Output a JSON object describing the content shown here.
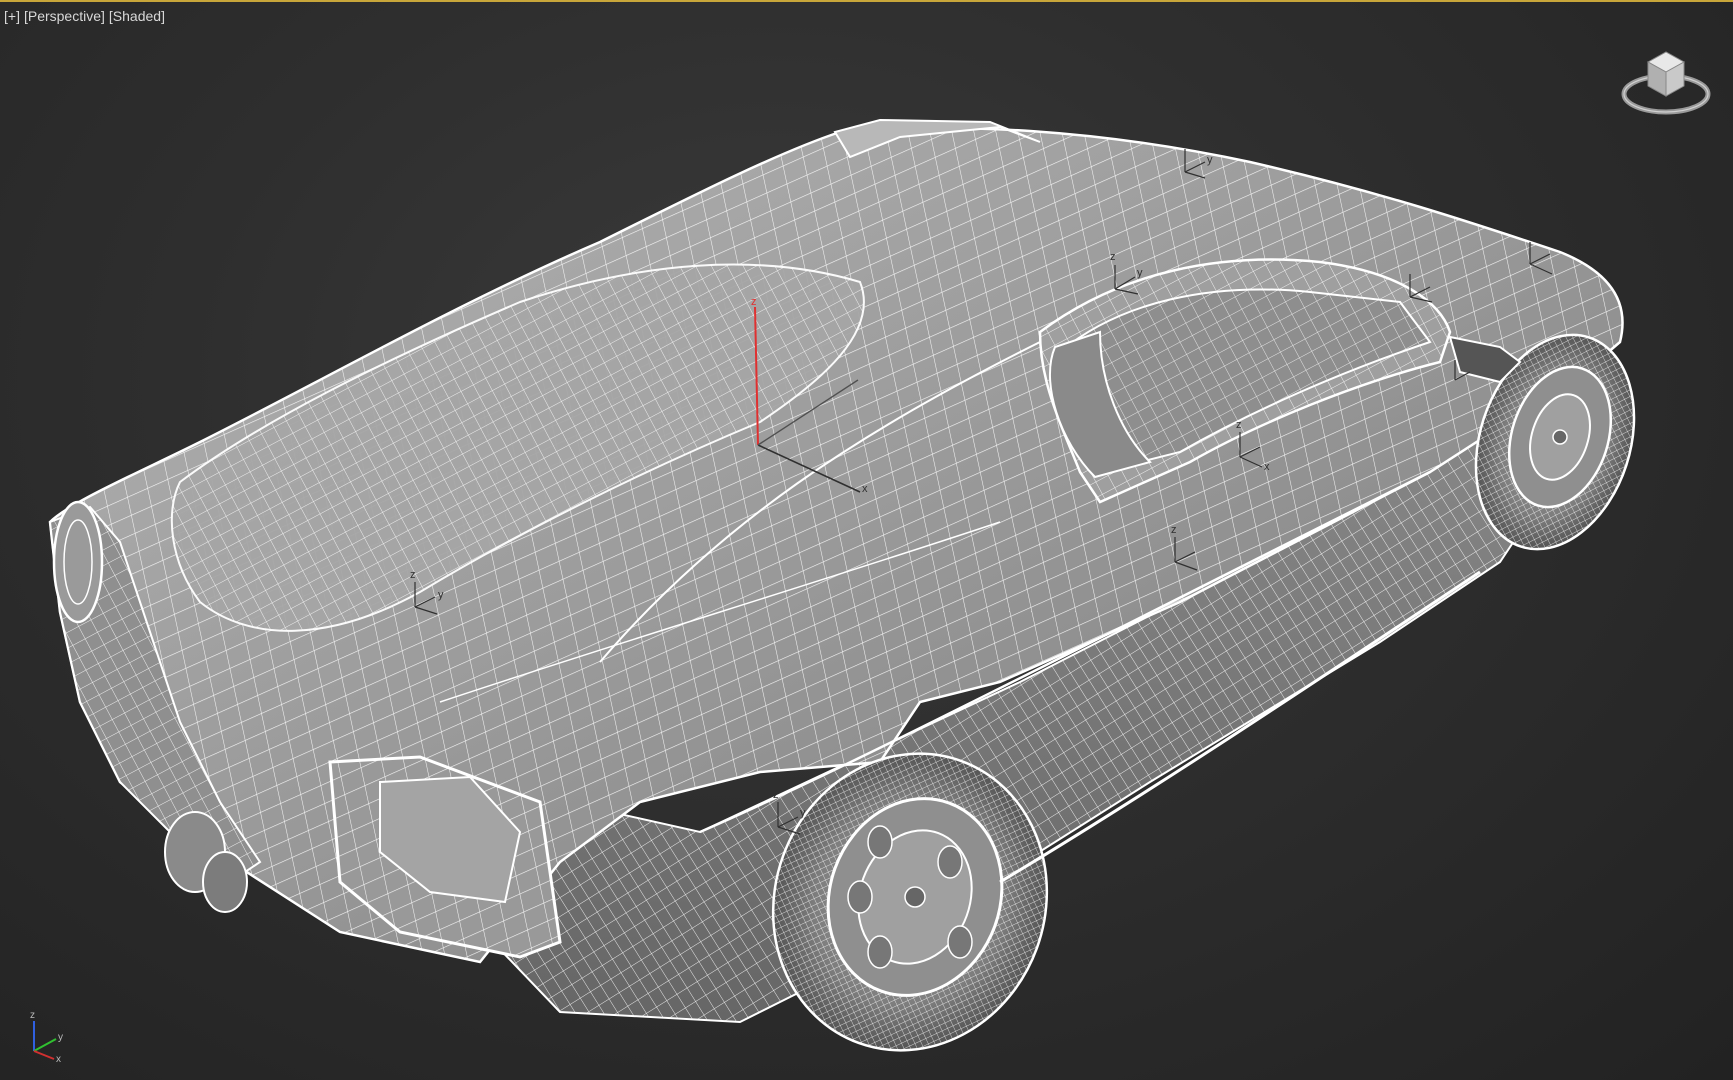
{
  "viewport": {
    "labels": [
      "+",
      "Perspective",
      "Shaded"
    ],
    "border_color": "#c8a63a",
    "background": "#2e2e2e"
  },
  "viewcube": {
    "icon": "viewcube-icon"
  },
  "world_axis": {
    "icon": "world-axis-icon",
    "z_label": "z",
    "y_label": "y",
    "x_label": "x",
    "colors": {
      "x": "#d03030",
      "y": "#30c030",
      "z": "#3060e0"
    }
  },
  "gizmo": {
    "z_label": "z",
    "x_label": "x",
    "z_color": "#e03030"
  },
  "pivot_label": {
    "z": "z",
    "y": "y",
    "x": "x"
  },
  "model": {
    "name": "car-wireframe-model",
    "wire_color": "#ffffff",
    "shade_color": "#9a9a9a"
  }
}
